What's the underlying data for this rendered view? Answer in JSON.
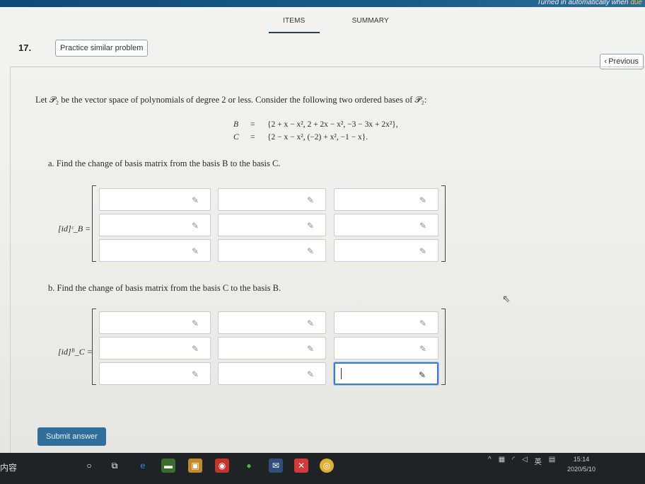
{
  "notice": {
    "text": "Turned in automatically when ",
    "highlight": "due"
  },
  "tabs": [
    {
      "label": "ITEMS"
    },
    {
      "label": "SUMMARY"
    }
  ],
  "question_number": "17.",
  "practice_button": "Practice similar problem",
  "previous_button": "Previous",
  "intro_text": "Let 𝒫₂ be the vector space of polynomials of degree 2 or less. Consider the following two ordered bases of 𝒫₂:",
  "basis_b": {
    "symbol": "B",
    "eq": "=",
    "value": "{2 + x − x², 2 + 2x − x², −3 − 3x + 2x²},"
  },
  "basis_c": {
    "symbol": "C",
    "eq": "=",
    "value": "{2 − x − x², (−2) + x², −1 − x}."
  },
  "part_a": "a. Find the change of basis matrix from the basis B to the basis C.",
  "part_b": "b. Find the change of basis matrix from the basis C to the basis B.",
  "matrix_a_label": "[id]ᶜ_B =",
  "matrix_b_label": "[id]ᴮ_C =",
  "matrix_a_values": [
    "",
    "",
    "",
    "",
    "",
    "",
    "",
    "",
    ""
  ],
  "matrix_b_values": [
    "",
    "",
    "",
    "",
    "",
    "",
    "",
    "",
    ""
  ],
  "submit_button": "Submit answer",
  "taskbar": {
    "left_text": "内容",
    "ime": "英",
    "time": "15:14",
    "date": "2020/5/10"
  },
  "colors": {
    "accent": "#2f6e9b",
    "focus": "#3f7fbf"
  },
  "icons": [
    "pencil-icon",
    "chevron-left-icon",
    "cursor-icon"
  ]
}
